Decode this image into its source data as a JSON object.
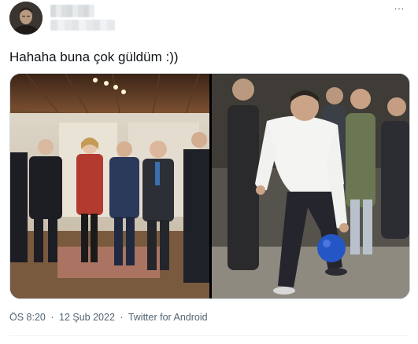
{
  "tweet": {
    "text": "Hahaha buna çok güldüm :))",
    "more_label": "···",
    "timestamp": "ÖS 8:20",
    "date": "12 Şub 2022",
    "client": "Twitter for Android",
    "separator": "·"
  },
  "media": {
    "count": 2
  }
}
